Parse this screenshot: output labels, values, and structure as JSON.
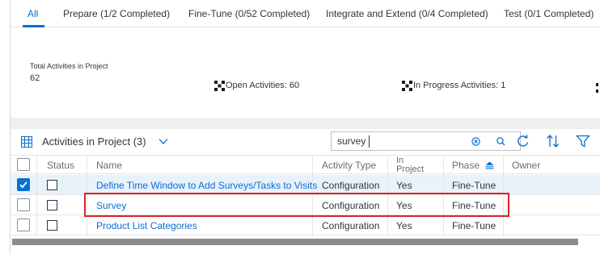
{
  "tabs": [
    {
      "label": "All",
      "active": true
    },
    {
      "label": "Prepare (1/2 Completed)"
    },
    {
      "label": "Fine-Tune (0/52 Completed)"
    },
    {
      "label": "Integrate and Extend (0/4 Completed)"
    },
    {
      "label": "Test (0/1 Completed)"
    }
  ],
  "summary": {
    "total_label": "Total Activities in Project",
    "total_value": "62",
    "open": "Open Activities:  60",
    "in_progress": "In Progress Activities:  1"
  },
  "table": {
    "title": "Activities in Project  (3)",
    "search_value": "survey",
    "columns": {
      "status": "Status",
      "name": "Name",
      "activity_type": "Activity Type",
      "in_project_1": "In",
      "in_project_2": "Project",
      "phase": "Phase",
      "owner": "Owner"
    },
    "rows": [
      {
        "selected": true,
        "name": "Define Time Window to Add Surveys/Tasks to Visits",
        "activity_type": "Configuration",
        "in_project": "Yes",
        "phase": "Fine-Tune",
        "owner": ""
      },
      {
        "selected": false,
        "name": "Survey",
        "activity_type": "Configuration",
        "in_project": "Yes",
        "phase": "Fine-Tune",
        "owner": ""
      },
      {
        "selected": false,
        "name": "Product List Categories",
        "activity_type": "Configuration",
        "in_project": "Yes",
        "phase": "Fine-Tune",
        "owner": ""
      }
    ]
  },
  "colors": {
    "accent": "#0a6ed1",
    "highlight_border": "#e0202a",
    "selected_row": "#e8f2fb"
  }
}
